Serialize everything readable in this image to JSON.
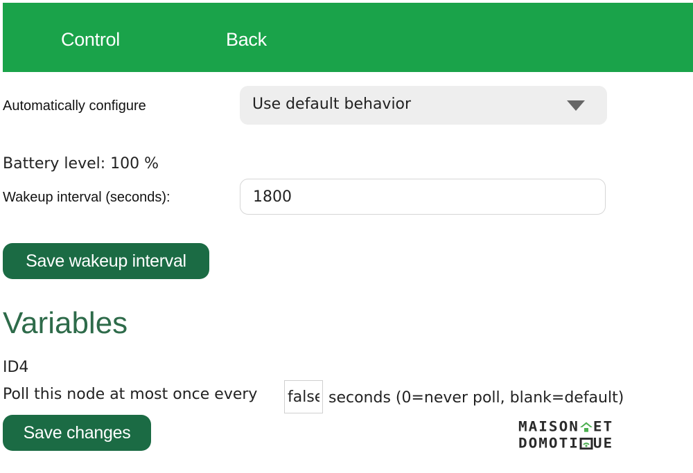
{
  "nav": {
    "control_label": "Control",
    "back_label": "Back"
  },
  "auto_config": {
    "label": "Automatically configure",
    "selected": "Use default behavior"
  },
  "battery": {
    "text": "Battery level: 100 %"
  },
  "wakeup": {
    "label": "Wakeup interval (seconds):",
    "value": "1800",
    "save_label": "Save wakeup interval"
  },
  "variables": {
    "heading": "Variables",
    "id_label": "ID4",
    "poll_prefix": "Poll this node at most once every",
    "poll_value": "false",
    "poll_suffix": "seconds (0=never poll, blank=default)",
    "save_label": "Save changes"
  },
  "logo": {
    "line1_a": "MAISON",
    "line1_b": "ET",
    "line2_a": "DOMOTI",
    "line2_b": "UE"
  },
  "colors": {
    "topbar": "#1aa34a",
    "button": "#1b6b44",
    "heading": "#2e6b4a",
    "logo_accent": "#4caf50"
  }
}
